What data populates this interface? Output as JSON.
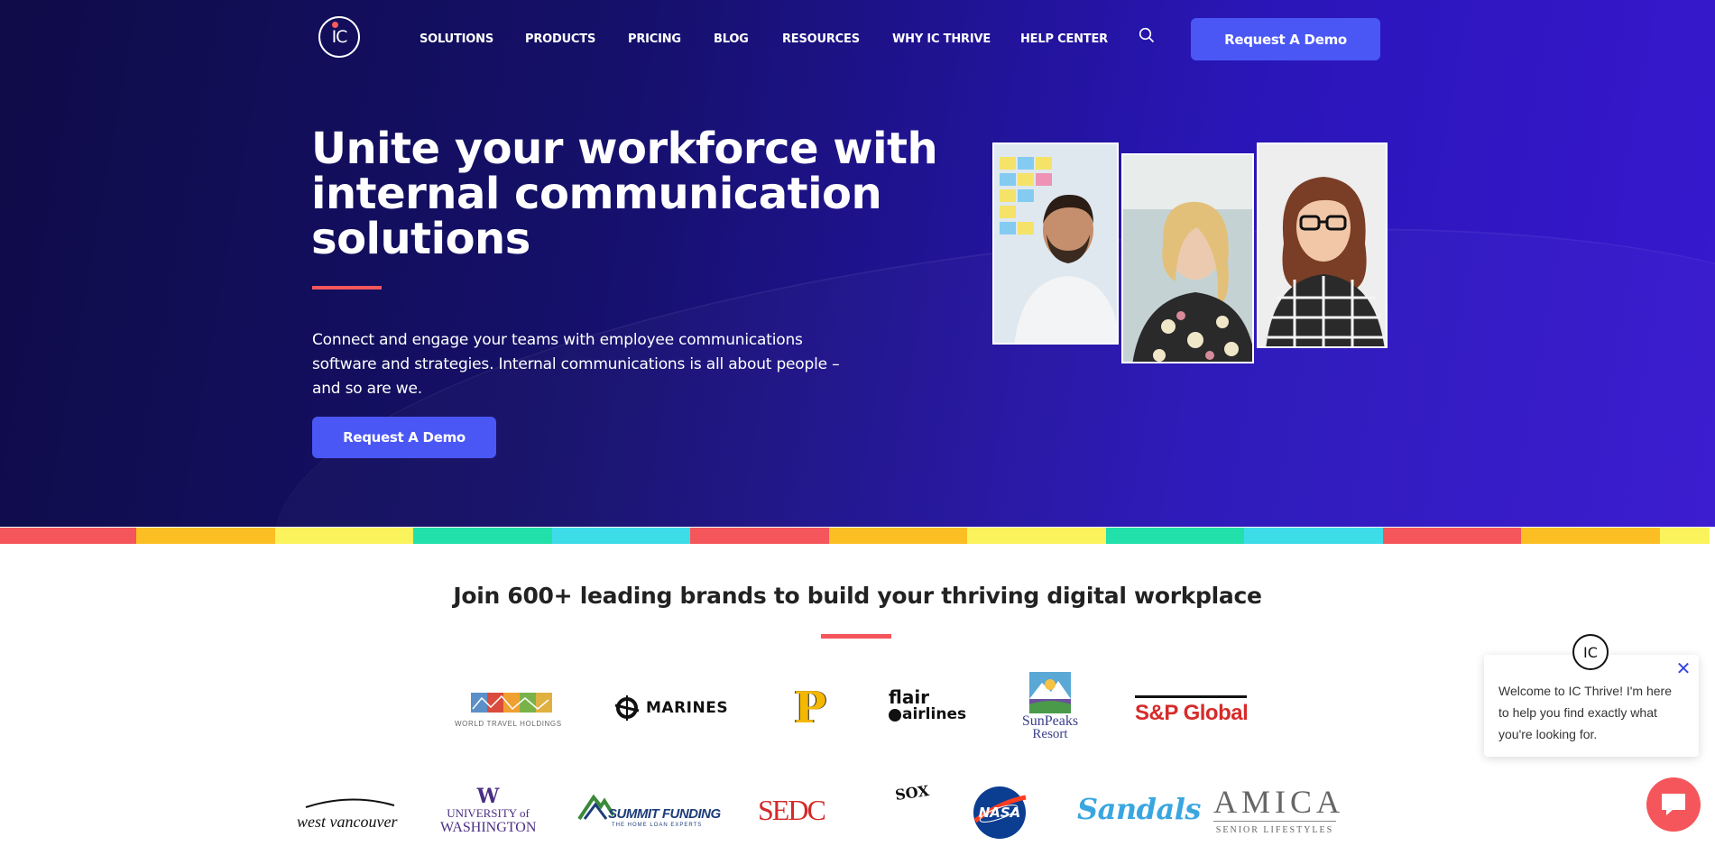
{
  "header": {
    "logo_text": "IC",
    "nav": [
      "SOLUTIONS",
      "PRODUCTS",
      "PRICING",
      "BLOG",
      "RESOURCES",
      "WHY IC THRIVE",
      "HELP CENTER"
    ],
    "search_icon": "search-icon",
    "cta_label": "Request A Demo"
  },
  "hero": {
    "headline_line1": "Unite your workforce with",
    "headline_line2": "internal communication",
    "headline_line3": "solutions",
    "subtext_line1": "Connect and engage your teams with employee communications",
    "subtext_line2": "software and strategies. Internal communications is all about people –",
    "subtext_line3": "and so are we.",
    "cta_label": "Request A Demo",
    "accent_color": "#f4565b",
    "button_color": "#4a57f5"
  },
  "stripe_colors": [
    "#f4565b",
    "#fbbf24",
    "#fbf35c",
    "#21e0a9",
    "#3ddce9",
    "#f4565b",
    "#fbbf24",
    "#fbf35c",
    "#21e0a9",
    "#3ddce9",
    "#f4565b",
    "#fbbf24",
    "#fbf35c"
  ],
  "brands": {
    "title": "Join 600+ leading brands to build your thriving digital workplace",
    "row1": {
      "world_travel": "WORLD TRAVEL HOLDINGS",
      "marines": "MARINES",
      "pirates": "P",
      "flair1": "flair",
      "flair2": "airlines",
      "sunpeaks1": "SunPeaks",
      "sunpeaks2": "Resort",
      "sp_global": "S&P Global"
    },
    "row2": {
      "west_vancouver": "west vancouver",
      "uw_w": "W",
      "uw1": "UNIVERSITY of",
      "uw2": "WASHINGTON",
      "summit1": "SUMMIT FUNDING",
      "summit2": "THE HOME LOAN EXPERTS",
      "sedc": "SEDC",
      "whitesox": "SOX",
      "nasa": "NASA",
      "sandals": "Sandals",
      "amica1": "AMICA",
      "amica2": "SENIOR LIFESTYLES"
    }
  },
  "chat": {
    "logo_text": "IC",
    "message_line1": "Welcome to IC Thrive! I'm here",
    "message_line2": "to help you find exactly what",
    "message_line3": "you're looking for.",
    "close_icon": "close-icon",
    "bubble_icon": "chat-bubble-icon"
  }
}
